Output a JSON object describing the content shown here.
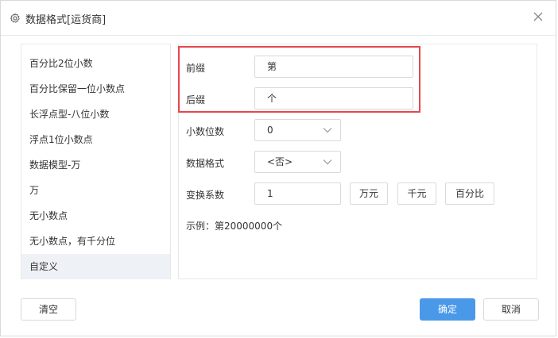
{
  "dialog": {
    "title": "数据格式[运货商]",
    "icon": "gear-icon",
    "close_icon": "close-icon"
  },
  "formats": {
    "items": [
      {
        "label": "百分比2位小数"
      },
      {
        "label": "百分比保留一位小数点"
      },
      {
        "label": "长浮点型-八位小数"
      },
      {
        "label": "浮点1位小数点"
      },
      {
        "label": "数据模型-万"
      },
      {
        "label": "万"
      },
      {
        "label": "无小数点"
      },
      {
        "label": "无小数点，有千分位"
      },
      {
        "label": "自定义"
      }
    ],
    "selected_index": 8
  },
  "form": {
    "prefix_label": "前缀",
    "prefix_value": "第",
    "suffix_label": "后缀",
    "suffix_value": "个",
    "decimals_label": "小数位数",
    "decimals_value": "0",
    "data_format_label": "数据格式",
    "data_format_value": "<否>",
    "factor_label": "变换系数",
    "factor_value": "1",
    "wan_button": "万元",
    "qian_button": "千元",
    "percent_button": "百分比",
    "example_text": "示例：第20000000个"
  },
  "footer": {
    "clear_label": "清空",
    "ok_label": "确定",
    "cancel_label": "取消"
  },
  "colors": {
    "primary": "#4a98e8",
    "highlight_border": "#e5474d",
    "selected_bg": "#eef1f5"
  }
}
